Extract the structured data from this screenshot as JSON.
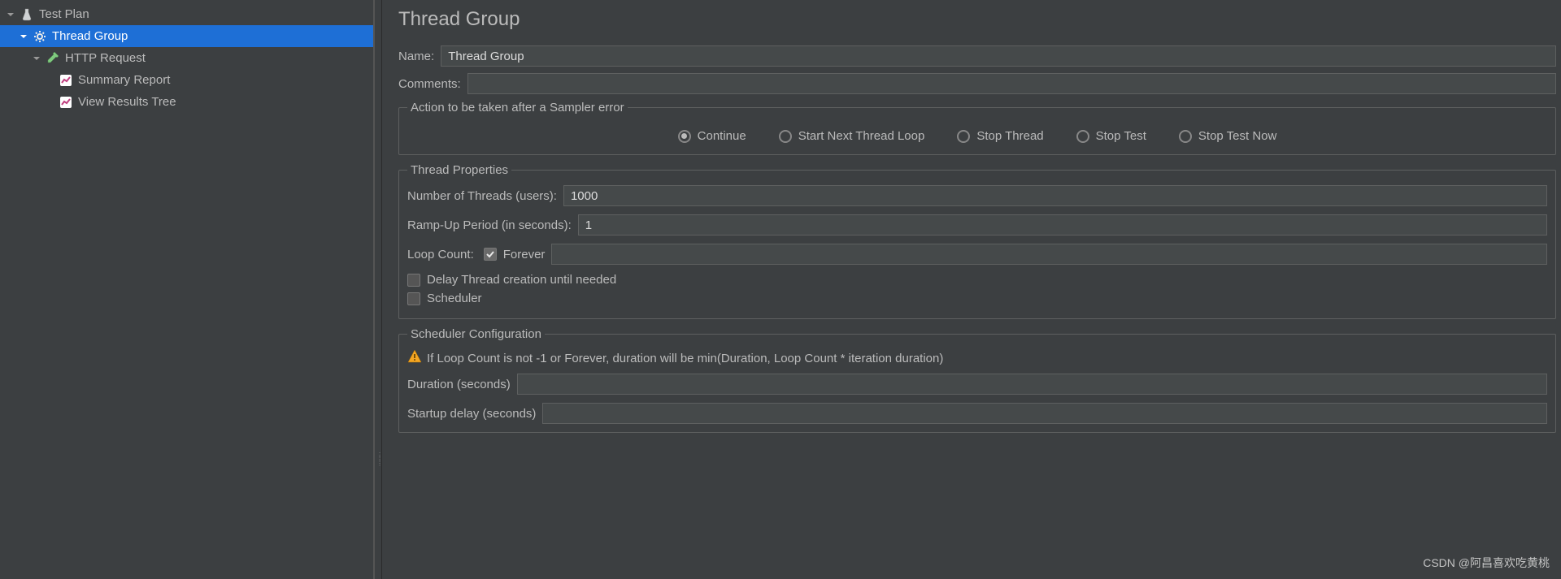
{
  "tree": {
    "items": [
      {
        "label": "Test Plan",
        "indent": 0,
        "icon": "beaker",
        "arrow": true
      },
      {
        "label": "Thread Group",
        "indent": 1,
        "icon": "gear",
        "arrow": true,
        "selected": true
      },
      {
        "label": "HTTP Request",
        "indent": 2,
        "icon": "pipette",
        "arrow": true
      },
      {
        "label": "Summary Report",
        "indent": 3,
        "icon": "chart",
        "arrow": false
      },
      {
        "label": "View Results Tree",
        "indent": 3,
        "icon": "chart",
        "arrow": false
      }
    ]
  },
  "panel": {
    "title": "Thread Group",
    "name_label": "Name:",
    "name_value": "Thread Group",
    "comments_label": "Comments:",
    "comments_value": "",
    "action_group": {
      "legend": "Action to be taken after a Sampler error",
      "options": [
        {
          "label": "Continue",
          "checked": true
        },
        {
          "label": "Start Next Thread Loop",
          "checked": false
        },
        {
          "label": "Stop Thread",
          "checked": false
        },
        {
          "label": "Stop Test",
          "checked": false
        },
        {
          "label": "Stop Test Now",
          "checked": false
        }
      ]
    },
    "thread_props": {
      "legend": "Thread Properties",
      "num_threads_label": "Number of Threads (users):",
      "num_threads_value": "1000",
      "ramp_label": "Ramp-Up Period (in seconds):",
      "ramp_value": "1",
      "loop_label": "Loop Count:",
      "forever_label": "Forever",
      "forever_checked": true,
      "loop_value": "",
      "delay_label": "Delay Thread creation until needed",
      "delay_checked": false,
      "scheduler_label": "Scheduler",
      "scheduler_checked": false
    },
    "scheduler_cfg": {
      "legend": "Scheduler Configuration",
      "warning": "If Loop Count is not -1 or Forever, duration will be min(Duration, Loop Count * iteration duration)",
      "duration_label": "Duration (seconds)",
      "duration_value": "",
      "startup_label": "Startup delay (seconds)",
      "startup_value": ""
    }
  },
  "watermark": "CSDN @阿昌喜欢吃黄桃"
}
